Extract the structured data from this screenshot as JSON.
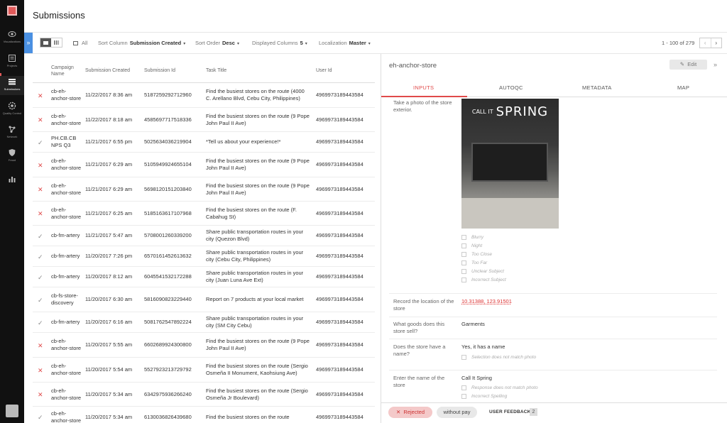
{
  "nav": {
    "items": [
      {
        "label": "Visualizations",
        "icon": "eye-icon"
      },
      {
        "label": "Projects",
        "icon": "projects-icon"
      },
      {
        "label": "Submissions",
        "icon": "submissions-icon"
      },
      {
        "label": "Quality Control",
        "icon": "quality-control-icon"
      },
      {
        "label": "Network",
        "icon": "network-icon"
      },
      {
        "label": "Fraud",
        "icon": "shield-icon"
      },
      {
        "label": "",
        "icon": "bar-chart-icon"
      }
    ],
    "active_index": 2,
    "accent_color": "#e25a5a"
  },
  "header": {
    "title": "Submissions"
  },
  "toolbar": {
    "collapse_icon": "chevron-right-double-icon",
    "all_label": "All",
    "sort_column_label": "Sort Column",
    "sort_column_value": "Submission Created",
    "sort_order_label": "Sort Order",
    "sort_order_value": "Desc",
    "displayed_columns_label": "Displayed Columns",
    "displayed_columns_value": "5",
    "localization_label": "Localization",
    "localization_value": "Master",
    "caret": "▾",
    "pagination": "1 - 100 of 279",
    "prev": "‹",
    "next": "›"
  },
  "table": {
    "columns": [
      "Campaign\nName",
      "Submission Created",
      "Submission Id",
      "Task Title",
      "User Id"
    ],
    "rows": [
      {
        "status": "rejected",
        "campaign": "cb-eh-anchor-store",
        "created": "11/22/2017 8:36 am",
        "id": "5187259292712960",
        "task": "Find the busiest stores on the route (4000 C. Arellano Blvd, Cebu City, Philippines)",
        "user": "4969973189443584"
      },
      {
        "status": "rejected",
        "campaign": "cb-eh-anchor-store",
        "created": "11/22/2017 8:18 am",
        "id": "4585697717518336",
        "task": "Find the busiest stores on the route (9 Pope John Paul II Ave)",
        "user": "4969973189443584"
      },
      {
        "status": "approved",
        "campaign": "PH.CB.CB NPS Q3",
        "created": "11/21/2017 6:55 pm",
        "id": "5025634036219904",
        "task": "*Tell us about your experience!*",
        "user": "4969973189443584"
      },
      {
        "status": "rejected",
        "campaign": "cb-eh-anchor-store",
        "created": "11/21/2017 6:29 am",
        "id": "5105949924655104",
        "task": "Find the busiest stores on the route (9 Pope John Paul II Ave)",
        "user": "4969973189443584"
      },
      {
        "status": "rejected",
        "campaign": "cb-eh-anchor-store",
        "created": "11/21/2017 6:29 am",
        "id": "5698120151203840",
        "task": "Find the busiest stores on the route (9 Pope John Paul II Ave)",
        "user": "4969973189443584"
      },
      {
        "status": "rejected",
        "campaign": "cb-eh-anchor-store",
        "created": "11/21/2017 6:25 am",
        "id": "5185163617107968",
        "task": "Find the busiest stores on the route (F. Cabahug St)",
        "user": "4969973189443584"
      },
      {
        "status": "approved",
        "campaign": "cb-fm-artery",
        "created": "11/21/2017 5:47 am",
        "id": "5708001260339200",
        "task": "Share public transportation routes in your city (Quezon Blvd)",
        "user": "4969973189443584"
      },
      {
        "status": "approved",
        "campaign": "cb-fm-artery",
        "created": "11/20/2017 7:26 pm",
        "id": "6570161452613632",
        "task": "Share public transportation routes in your city (Cebu City, Philippines)",
        "user": "4969973189443584"
      },
      {
        "status": "approved",
        "campaign": "cb-fm-artery",
        "created": "11/20/2017 8:12 am",
        "id": "6045541532172288",
        "task": "Share public transportation routes in your city (Juan Luna Ave Ext)",
        "user": "4969973189443584"
      },
      {
        "status": "approved",
        "campaign": "cb-fs-store-discovery",
        "created": "11/20/2017 6:30 am",
        "id": "5816090823229440",
        "task": "Report on 7 products at your local market",
        "user": "4969973189443584"
      },
      {
        "status": "approved",
        "campaign": "cb-fm-artery",
        "created": "11/20/2017 6:16 am",
        "id": "5081762547892224",
        "task": "Share public transportation routes in your city (SM City Cebu)",
        "user": "4969973189443584"
      },
      {
        "status": "rejected",
        "campaign": "cb-eh-anchor-store",
        "created": "11/20/2017 5:55 am",
        "id": "6602689924300800",
        "task": "Find the busiest stores on the route (9 Pope John Paul II Ave)",
        "user": "4969973189443584"
      },
      {
        "status": "rejected",
        "campaign": "cb-eh-anchor-store",
        "created": "11/20/2017 5:54 am",
        "id": "5527923213729792",
        "task": "Find the busiest stores on the route (Sergio Osmeña II Monument, Kaohsiung Ave)",
        "user": "4969973189443584"
      },
      {
        "status": "rejected",
        "campaign": "cb-eh-anchor-store",
        "created": "11/20/2017 5:34 am",
        "id": "6342975936266240",
        "task": "Find the busiest stores on the route (Sergio Osmeña Jr Boulevard)",
        "user": "4969973189443584"
      },
      {
        "status": "approved",
        "campaign": "cb-eh-anchor-store",
        "created": "11/20/2017 5:34 am",
        "id": "6130036826439680",
        "task": "Find the busiest stores on the route",
        "user": "4969973189443584"
      }
    ]
  },
  "detail": {
    "title": "eh-anchor-store",
    "edit_label": "Edit",
    "expand_icon": "chevron-right-double-icon",
    "tabs": [
      "INPUTS",
      "AUTOQC",
      "METADATA",
      "MAP"
    ],
    "active_tab": 0,
    "photo_question": "Take a photo of the store exterior.",
    "photo_sign_small": "CALL IT",
    "photo_sign_big": "SPRING",
    "photo_flags": [
      "Blurry",
      "Night",
      "Too Close",
      "Too Far",
      "Unclear Subject",
      "Incorrect Subject"
    ],
    "location_question": "Record the location of the store",
    "location_value": "10.31388, 123.91501",
    "goods_question": "What goods does this store sell?",
    "goods_value": "Garments",
    "name_question": "Does the store have a name?",
    "name_value": "Yes, it has a name",
    "name_flag": "Selection does not match photo",
    "enter_name_question": "Enter the name of the store",
    "enter_name_value": "Call It Spring",
    "enter_name_flags": [
      "Response does not match photo",
      "Incorrect Spelling"
    ]
  },
  "footer": {
    "rejected_label": "Rejected",
    "without_pay_label": "without pay",
    "user_feedback_label": "USER FEEDBACK",
    "user_feedback_count": "2"
  }
}
